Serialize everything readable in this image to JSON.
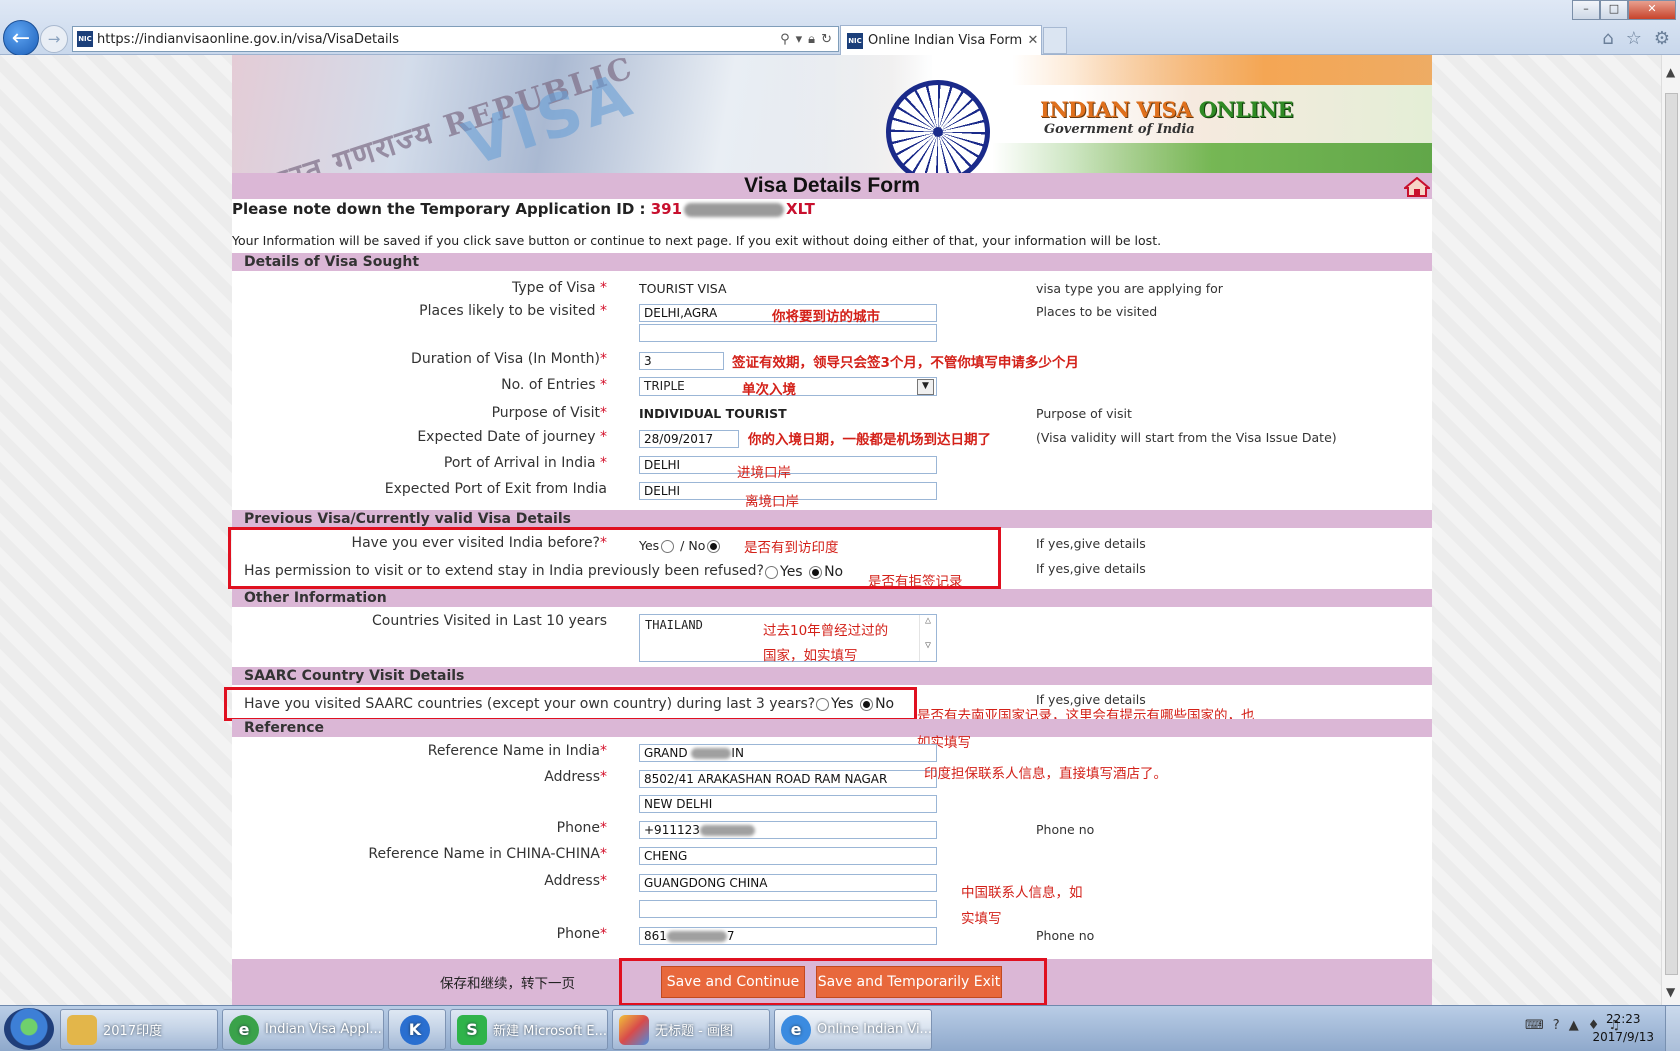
{
  "browser": {
    "url": "https://indianvisaonline.gov.in/visa/VisaDetails",
    "tab_title": "Online Indian Visa Form",
    "favicon_text": "NIC"
  },
  "banner": {
    "logo_line1": "INDIAN VISA ",
    "logo_line1_green": "ONLINE",
    "logo_line2": "Government of India"
  },
  "form": {
    "title": "Visa Details Form",
    "temp_id_label": "Please note down the Temporary Application ID : ",
    "temp_id_start": "391",
    "temp_id_end": "XLT",
    "notice": "Your Information will be saved if you click save button or continue to next page. If you exit without doing either of that, your information will be lost."
  },
  "visa_sought": {
    "header": "Details of Visa Sought",
    "type_label": "Type of Visa ",
    "type_value": "TOURIST VISA",
    "type_hint": "visa type you are applying for",
    "places_label": "Places likely to be visited ",
    "places_value": "DELHI,AGRA",
    "places_value2": "",
    "places_hint": "Places to be visited",
    "duration_label": "Duration of Visa (In Month)",
    "duration_value": "3",
    "entries_label": "No. of Entries ",
    "entries_value": "TRIPLE",
    "purpose_label": "Purpose of Visit",
    "purpose_value": "INDIVIDUAL TOURIST",
    "purpose_hint": "Purpose of visit",
    "date_label": "Expected Date of journey ",
    "date_value": "28/09/2017",
    "date_hint": "(Visa validity will start from the Visa Issue Date)",
    "arrival_label": "Port of Arrival in India ",
    "arrival_value": "DELHI",
    "exit_label": "Expected Port of Exit from India",
    "exit_value": "DELHI",
    "required_mark": "*"
  },
  "previous_visa": {
    "header": "Previous Visa/Currently valid Visa Details",
    "visited_q": "Have you ever visited India before?",
    "yes": "Yes",
    "slash": " / ",
    "no": "No",
    "visited_hint": "If yes,give details",
    "refused_q": "Has permission to visit or to extend stay in India previously been refused?",
    "refused_hint": "If yes,give details"
  },
  "other_info": {
    "header": "Other Information",
    "countries_label": "Countries Visited in Last 10 years",
    "countries_value": "THAILAND"
  },
  "saarc": {
    "header": "SAARC Country Visit Details",
    "question": "Have you visited SAARC countries (except your own country) during last 3 years?",
    "hint": "If yes,give details"
  },
  "reference": {
    "header": "Reference",
    "india_name_label": "Reference Name in India",
    "india_name_value_start": "GRAND",
    "india_name_value_end": "IN",
    "india_address_label": "Address",
    "india_address1": "8502/41 ARAKASHAN ROAD RAM NAGAR",
    "india_address2": "NEW DELHI",
    "india_phone_label": "Phone",
    "india_phone_value": "+911123",
    "india_phone_hint": "Phone no",
    "china_name_label": "Reference Name in CHINA-CHINA",
    "china_name_value": "CHENG",
    "china_address_label": "Address",
    "china_address1": "GUANGDONG CHINA",
    "china_address2": "",
    "china_phone_label": "Phone",
    "china_phone_value_start": "861",
    "china_phone_value_end": "7",
    "china_phone_hint": "Phone no"
  },
  "actions": {
    "save_continue": "Save and Continue",
    "save_exit": "Save and Temporarily Exit"
  },
  "annotations": {
    "places": "你将要到访的城市",
    "duration": "签证有效期，领导只会签3个月，不管你填写申请多少个月",
    "entries": "单次入境",
    "date": "你的入境日期，一般都是机场到达日期了",
    "arrival": "进境口岸",
    "exit": "离境口岸",
    "visited": "是否有到访印度",
    "refused": "是否有拒签记录",
    "countries1": "过去10年曾经过过的",
    "countries2": "国家，如实填写",
    "saarc1": "是否有去南亚国家记录，这里会有提示有哪些国家的，也",
    "saarc2": "如实填写",
    "india_ref": "印度担保联系人信息，直接填写酒店了。",
    "china_ref1": "中国联系人信息，如",
    "china_ref2": "实填写",
    "save_continue": "保存和继续，转下一页"
  },
  "taskbar": {
    "items": [
      {
        "label": "2017印度",
        "icon": "folder-icon"
      },
      {
        "label": "Indian Visa Appl...",
        "icon": "browser-icon"
      },
      {
        "label": "",
        "icon": "k-app-icon"
      },
      {
        "label": "新建 Microsoft E...",
        "icon": "spreadsheet-icon"
      },
      {
        "label": "无标题 - 画图",
        "icon": "paint-icon"
      },
      {
        "label": "Online Indian Vi...",
        "icon": "ie-icon"
      }
    ],
    "time": "22:23",
    "date": "2017/9/13"
  },
  "colors": {
    "section_bg": "#dbb7d6",
    "required": "#d4102a",
    "annotation": "#d32018",
    "button": "#e8683c",
    "highlight_box": "#e01020"
  }
}
